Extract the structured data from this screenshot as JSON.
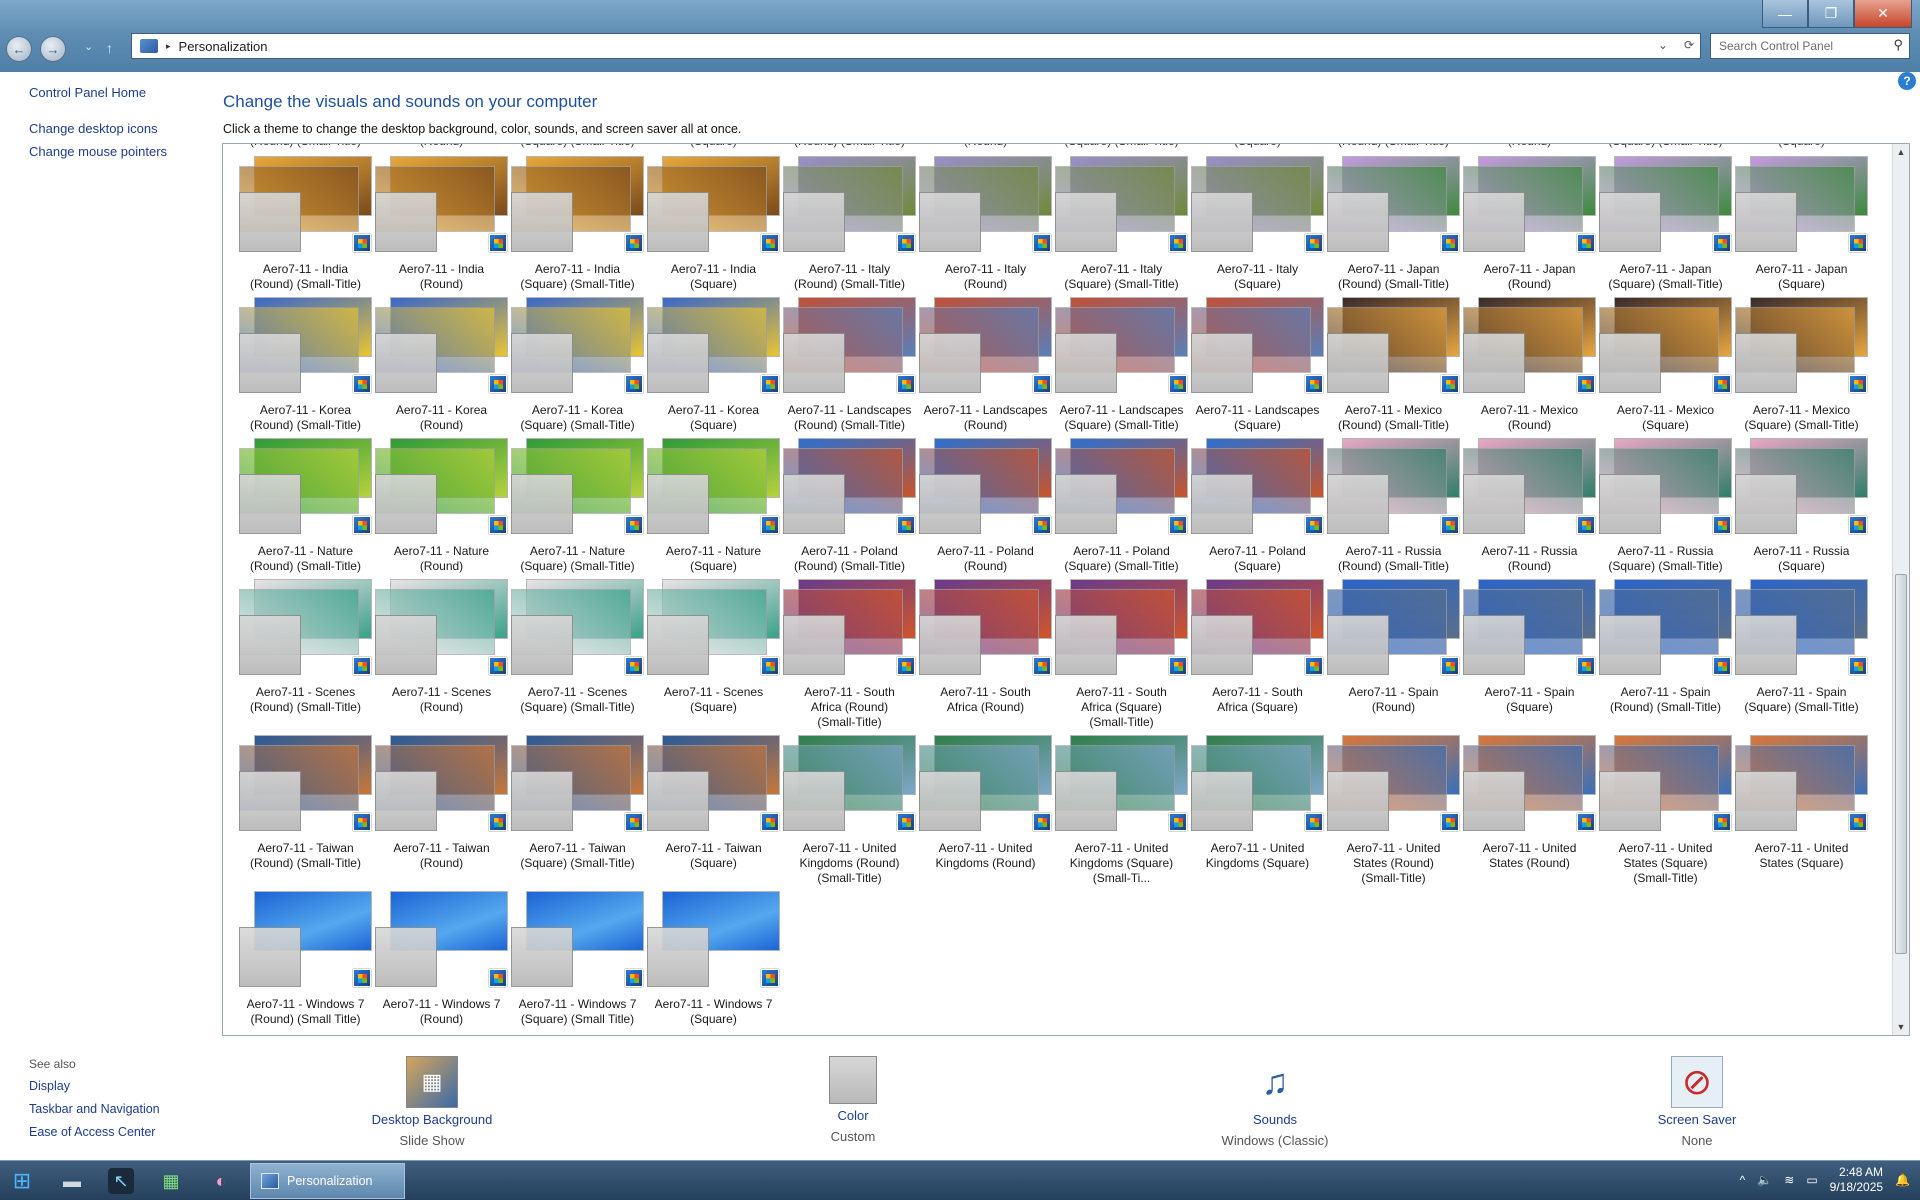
{
  "window": {
    "minimize_glyph": "—",
    "maximize_glyph": "❐",
    "close_glyph": "✕"
  },
  "address": {
    "back_glyph": "←",
    "forward_glyph": "→",
    "up_glyph": "↑",
    "separator": "▸",
    "path": "Personalization",
    "dropdown_glyph": "⌄",
    "refresh_glyph": "⟳"
  },
  "search": {
    "placeholder": "Search Control Panel",
    "icon": "magnifier-icon",
    "icon_glyph": "⚲"
  },
  "help": {
    "label": "?"
  },
  "left_nav": {
    "home": "Control Panel Home",
    "links": [
      "Change desktop icons",
      "Change mouse pointers"
    ],
    "see_also_title": "See also",
    "see_also": [
      "Display",
      "Taskbar and Navigation",
      "Ease of Access Center"
    ]
  },
  "main": {
    "heading": "Change the visuals and sounds on your computer",
    "subheading": "Click a theme to change the desktop background, color, sounds, and screen saver all at once."
  },
  "clipped_row": [
    "(Round) (Small-Title)",
    "(Round)",
    "(Square) (Small-Title)",
    "(Square)",
    "(Round) (Small-Title)",
    "(Round)",
    "(Square) (Small-Title)",
    "(Square)",
    "(Round) (Small-Title)",
    "(Round)",
    "(Square) (Small-Title)",
    "(Square)"
  ],
  "themes": [
    {
      "line1": "Aero7-11 - India",
      "line2": "(Round) (Small-Title)",
      "c1": "#e7a83b",
      "c2": "#7a4b1c"
    },
    {
      "line1": "Aero7-11 - India",
      "line2": "(Round)",
      "c1": "#e7a83b",
      "c2": "#7a4b1c"
    },
    {
      "line1": "Aero7-11 - India",
      "line2": "(Square) (Small-Title)",
      "c1": "#e7a83b",
      "c2": "#7a4b1c"
    },
    {
      "line1": "Aero7-11 - India",
      "line2": "(Square)",
      "c1": "#e7a83b",
      "c2": "#7a4b1c"
    },
    {
      "line1": "Aero7-11 - Italy",
      "line2": "(Round) (Small-Title)",
      "c1": "#9a8fc9",
      "c2": "#6f8a3a"
    },
    {
      "line1": "Aero7-11 - Italy",
      "line2": "(Round)",
      "c1": "#9a8fc9",
      "c2": "#6f8a3a"
    },
    {
      "line1": "Aero7-11 - Italy",
      "line2": "(Square) (Small-Title)",
      "c1": "#9a8fc9",
      "c2": "#6f8a3a"
    },
    {
      "line1": "Aero7-11 - Italy",
      "line2": "(Square)",
      "c1": "#9a8fc9",
      "c2": "#6f8a3a"
    },
    {
      "line1": "Aero7-11 - Japan",
      "line2": "(Round) (Small-Title)",
      "c1": "#c49be0",
      "c2": "#3d8a3e"
    },
    {
      "line1": "Aero7-11 - Japan",
      "line2": "(Round)",
      "c1": "#c49be0",
      "c2": "#3d8a3e"
    },
    {
      "line1": "Aero7-11 - Japan",
      "line2": "(Square) (Small-Title)",
      "c1": "#c49be0",
      "c2": "#3d8a3e"
    },
    {
      "line1": "Aero7-11 - Japan",
      "line2": "(Square)",
      "c1": "#c49be0",
      "c2": "#3d8a3e"
    },
    {
      "line1": "Aero7-11 - Korea",
      "line2": "(Round) (Small-Title)",
      "c1": "#3b67c8",
      "c2": "#e9c531"
    },
    {
      "line1": "Aero7-11 - Korea",
      "line2": "(Round)",
      "c1": "#3b67c8",
      "c2": "#e9c531"
    },
    {
      "line1": "Aero7-11 - Korea",
      "line2": "(Square) (Small-Title)",
      "c1": "#3b67c8",
      "c2": "#e9c531"
    },
    {
      "line1": "Aero7-11 - Korea",
      "line2": "(Square)",
      "c1": "#3b67c8",
      "c2": "#e9c531"
    },
    {
      "line1": "Aero7-11 - Landscapes",
      "line2": "(Round) (Small-Title)",
      "c1": "#c0503a",
      "c2": "#5a7fb8"
    },
    {
      "line1": "Aero7-11 - Landscapes",
      "line2": "(Round)",
      "c1": "#c0503a",
      "c2": "#5a7fb8"
    },
    {
      "line1": "Aero7-11 - Landscapes",
      "line2": "(Square) (Small-Title)",
      "c1": "#c0503a",
      "c2": "#5a7fb8"
    },
    {
      "line1": "Aero7-11 - Landscapes",
      "line2": "(Square)",
      "c1": "#c0503a",
      "c2": "#5a7fb8"
    },
    {
      "line1": "Aero7-11 - Mexico",
      "line2": "(Round) (Small-Title)",
      "c1": "#3a2a2a",
      "c2": "#e8a640"
    },
    {
      "line1": "Aero7-11 - Mexico",
      "line2": "(Round)",
      "c1": "#3a2a2a",
      "c2": "#e8a640"
    },
    {
      "line1": "Aero7-11 - Mexico",
      "line2": "(Square)",
      "c1": "#3a2a2a",
      "c2": "#e8a640"
    },
    {
      "line1": "Aero7-11 - Mexico",
      "line2": "(Square) (Small-Title)",
      "c1": "#3a2a2a",
      "c2": "#e8a640"
    },
    {
      "line1": "Aero7-11 - Nature",
      "line2": "(Round) (Small-Title)",
      "c1": "#2f9a3a",
      "c2": "#b7d23b"
    },
    {
      "line1": "Aero7-11 - Nature",
      "line2": "(Round)",
      "c1": "#2f9a3a",
      "c2": "#b7d23b"
    },
    {
      "line1": "Aero7-11 - Nature",
      "line2": "(Square) (Small-Title)",
      "c1": "#2f9a3a",
      "c2": "#b7d23b"
    },
    {
      "line1": "Aero7-11 - Nature",
      "line2": "(Square)",
      "c1": "#2f9a3a",
      "c2": "#b7d23b"
    },
    {
      "line1": "Aero7-11 - Poland",
      "line2": "(Round) (Small-Title)",
      "c1": "#2c6fd0",
      "c2": "#c9542a"
    },
    {
      "line1": "Aero7-11 - Poland",
      "line2": "(Round)",
      "c1": "#2c6fd0",
      "c2": "#c9542a"
    },
    {
      "line1": "Aero7-11 - Poland",
      "line2": "(Square) (Small-Title)",
      "c1": "#2c6fd0",
      "c2": "#c9542a"
    },
    {
      "line1": "Aero7-11 - Poland",
      "line2": "(Square)",
      "c1": "#2c6fd0",
      "c2": "#c9542a"
    },
    {
      "line1": "Aero7-11 - Russia",
      "line2": "(Round) (Small-Title)",
      "c1": "#e8a7c3",
      "c2": "#2f7f6a"
    },
    {
      "line1": "Aero7-11 - Russia",
      "line2": "(Round)",
      "c1": "#e8a7c3",
      "c2": "#2f7f6a"
    },
    {
      "line1": "Aero7-11 - Russia",
      "line2": "(Square) (Small-Title)",
      "c1": "#e8a7c3",
      "c2": "#2f7f6a"
    },
    {
      "line1": "Aero7-11 - Russia",
      "line2": "(Square)",
      "c1": "#e8a7c3",
      "c2": "#2f7f6a"
    },
    {
      "line1": "Aero7-11 - Scenes",
      "line2": "(Round) (Small-Title)",
      "c1": "#e9e2e6",
      "c2": "#3aa18a"
    },
    {
      "line1": "Aero7-11 - Scenes",
      "line2": "(Round)",
      "c1": "#e9e2e6",
      "c2": "#3aa18a"
    },
    {
      "line1": "Aero7-11 - Scenes",
      "line2": "(Square) (Small-Title)",
      "c1": "#e9e2e6",
      "c2": "#3aa18a"
    },
    {
      "line1": "Aero7-11 - Scenes",
      "line2": "(Square)",
      "c1": "#e9e2e6",
      "c2": "#3aa18a"
    },
    {
      "line1": "Aero7-11 - South",
      "line2": "Africa (Round)",
      "line3": "(Small-Title)",
      "c1": "#6a3a8a",
      "c2": "#d0552c"
    },
    {
      "line1": "Aero7-11 - South",
      "line2": "Africa (Round)",
      "c1": "#6a3a8a",
      "c2": "#d0552c"
    },
    {
      "line1": "Aero7-11 - South",
      "line2": "Africa (Square)",
      "line3": "(Small-Title)",
      "c1": "#6a3a8a",
      "c2": "#d0552c"
    },
    {
      "line1": "Aero7-11 - South",
      "line2": "Africa (Square)",
      "c1": "#6a3a8a",
      "c2": "#d0552c"
    },
    {
      "line1": "Aero7-11 - Spain",
      "line2": "(Round)",
      "c1": "#2a64c9",
      "c2": "#5a6f8a"
    },
    {
      "line1": "Aero7-11 - Spain",
      "line2": "(Square)",
      "c1": "#2a64c9",
      "c2": "#5a6f8a"
    },
    {
      "line1": "Aero7-11 - Spain",
      "line2": "(Round) (Small-Title)",
      "c1": "#2a64c9",
      "c2": "#5a6f8a"
    },
    {
      "line1": "Aero7-11 - Spain",
      "line2": "(Square) (Small-Title)",
      "c1": "#2a64c9",
      "c2": "#5a6f8a"
    },
    {
      "line1": "Aero7-11 - Taiwan",
      "line2": "(Round) (Small-Title)",
      "c1": "#2b5a98",
      "c2": "#c9773a"
    },
    {
      "line1": "Aero7-11 - Taiwan",
      "line2": "(Round)",
      "c1": "#2b5a98",
      "c2": "#c9773a"
    },
    {
      "line1": "Aero7-11 - Taiwan",
      "line2": "(Square) (Small-Title)",
      "c1": "#2b5a98",
      "c2": "#c9773a"
    },
    {
      "line1": "Aero7-11 - Taiwan",
      "line2": "(Square)",
      "c1": "#2b5a98",
      "c2": "#c9773a"
    },
    {
      "line1": "Aero7-11 - United",
      "line2": "Kingdoms (Round)",
      "line3": "(Small-Title)",
      "c1": "#2f7f4a",
      "c2": "#7fa6c9"
    },
    {
      "line1": "Aero7-11 - United",
      "line2": "Kingdoms (Round)",
      "c1": "#2f7f4a",
      "c2": "#7fa6c9"
    },
    {
      "line1": "Aero7-11 - United",
      "line2": "Kingdoms (Square)",
      "line3": "(Small-Ti...",
      "c1": "#2f7f4a",
      "c2": "#7fa6c9"
    },
    {
      "line1": "Aero7-11 - United",
      "line2": "Kingdoms (Square)",
      "c1": "#2f7f4a",
      "c2": "#7fa6c9"
    },
    {
      "line1": "Aero7-11 - United",
      "line2": "States (Round)",
      "line3": "(Small-Title)",
      "c1": "#d9773a",
      "c2": "#3a6fb8"
    },
    {
      "line1": "Aero7-11 - United",
      "line2": "States (Round)",
      "c1": "#d9773a",
      "c2": "#3a6fb8"
    },
    {
      "line1": "Aero7-11 - United",
      "line2": "States (Square)",
      "line3": "(Small-Title)",
      "c1": "#d9773a",
      "c2": "#3a6fb8"
    },
    {
      "line1": "Aero7-11 - United",
      "line2": "States (Square)",
      "c1": "#d9773a",
      "c2": "#3a6fb8"
    },
    {
      "line1": "Aero7-11 - Windows 7",
      "line2": "(Round) (Small Title)",
      "c1": "#1f6fd8",
      "c2": "#7fc3f2"
    },
    {
      "line1": "Aero7-11 - Windows 7",
      "line2": "(Round)",
      "c1": "#1f6fd8",
      "c2": "#7fc3f2"
    },
    {
      "line1": "Aero7-11 - Windows 7",
      "line2": "(Square) (Small Title)",
      "c1": "#1f6fd8",
      "c2": "#7fc3f2"
    },
    {
      "line1": "Aero7-11 - Windows 7",
      "line2": "(Square)",
      "c1": "#1f6fd8",
      "c2": "#7fc3f2"
    }
  ],
  "scroll": {
    "up_glyph": "▲",
    "down_glyph": "▼"
  },
  "bottom": [
    {
      "label": "Desktop Background",
      "value": "Slide Show",
      "icon": "desktop-background-icon",
      "glyph": "▦"
    },
    {
      "label": "Color",
      "value": "Custom",
      "icon": "color-swatch-icon",
      "glyph": ""
    },
    {
      "label": "Sounds",
      "value": "Windows (Classic)",
      "icon": "sounds-icon",
      "glyph": "♫"
    },
    {
      "label": "Screen Saver",
      "value": "None",
      "icon": "screen-saver-icon",
      "glyph": "⊘"
    }
  ],
  "taskbar": {
    "start_glyph": "⊞",
    "pinned": [
      {
        "icon": "file-explorer-icon",
        "glyph": "▬"
      },
      {
        "icon": "pointer-app-icon",
        "glyph": "↖"
      },
      {
        "icon": "grid-app-icon",
        "glyph": "▦"
      },
      {
        "icon": "copilot-icon",
        "glyph": "◐"
      }
    ],
    "active_app": "Personalization",
    "tray": {
      "chevron": "^",
      "volume_glyph": "🔈",
      "wifi_glyph": "≋",
      "battery_glyph": "▭",
      "notification_glyph": "🔔"
    },
    "time": "2:48 AM",
    "date": "9/18/2025"
  }
}
